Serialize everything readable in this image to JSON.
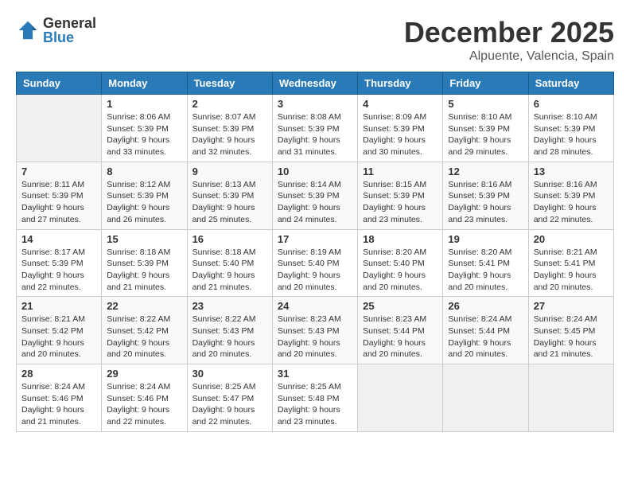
{
  "header": {
    "logo_general": "General",
    "logo_blue": "Blue",
    "month": "December 2025",
    "location": "Alpuente, Valencia, Spain"
  },
  "days_of_week": [
    "Sunday",
    "Monday",
    "Tuesday",
    "Wednesday",
    "Thursday",
    "Friday",
    "Saturday"
  ],
  "weeks": [
    [
      {
        "day": "",
        "info": ""
      },
      {
        "day": "1",
        "info": "Sunrise: 8:06 AM\nSunset: 5:39 PM\nDaylight: 9 hours\nand 33 minutes."
      },
      {
        "day": "2",
        "info": "Sunrise: 8:07 AM\nSunset: 5:39 PM\nDaylight: 9 hours\nand 32 minutes."
      },
      {
        "day": "3",
        "info": "Sunrise: 8:08 AM\nSunset: 5:39 PM\nDaylight: 9 hours\nand 31 minutes."
      },
      {
        "day": "4",
        "info": "Sunrise: 8:09 AM\nSunset: 5:39 PM\nDaylight: 9 hours\nand 30 minutes."
      },
      {
        "day": "5",
        "info": "Sunrise: 8:10 AM\nSunset: 5:39 PM\nDaylight: 9 hours\nand 29 minutes."
      },
      {
        "day": "6",
        "info": "Sunrise: 8:10 AM\nSunset: 5:39 PM\nDaylight: 9 hours\nand 28 minutes."
      }
    ],
    [
      {
        "day": "7",
        "info": "Sunrise: 8:11 AM\nSunset: 5:39 PM\nDaylight: 9 hours\nand 27 minutes."
      },
      {
        "day": "8",
        "info": "Sunrise: 8:12 AM\nSunset: 5:39 PM\nDaylight: 9 hours\nand 26 minutes."
      },
      {
        "day": "9",
        "info": "Sunrise: 8:13 AM\nSunset: 5:39 PM\nDaylight: 9 hours\nand 25 minutes."
      },
      {
        "day": "10",
        "info": "Sunrise: 8:14 AM\nSunset: 5:39 PM\nDaylight: 9 hours\nand 24 minutes."
      },
      {
        "day": "11",
        "info": "Sunrise: 8:15 AM\nSunset: 5:39 PM\nDaylight: 9 hours\nand 23 minutes."
      },
      {
        "day": "12",
        "info": "Sunrise: 8:16 AM\nSunset: 5:39 PM\nDaylight: 9 hours\nand 23 minutes."
      },
      {
        "day": "13",
        "info": "Sunrise: 8:16 AM\nSunset: 5:39 PM\nDaylight: 9 hours\nand 22 minutes."
      }
    ],
    [
      {
        "day": "14",
        "info": "Sunrise: 8:17 AM\nSunset: 5:39 PM\nDaylight: 9 hours\nand 22 minutes."
      },
      {
        "day": "15",
        "info": "Sunrise: 8:18 AM\nSunset: 5:39 PM\nDaylight: 9 hours\nand 21 minutes."
      },
      {
        "day": "16",
        "info": "Sunrise: 8:18 AM\nSunset: 5:40 PM\nDaylight: 9 hours\nand 21 minutes."
      },
      {
        "day": "17",
        "info": "Sunrise: 8:19 AM\nSunset: 5:40 PM\nDaylight: 9 hours\nand 20 minutes."
      },
      {
        "day": "18",
        "info": "Sunrise: 8:20 AM\nSunset: 5:40 PM\nDaylight: 9 hours\nand 20 minutes."
      },
      {
        "day": "19",
        "info": "Sunrise: 8:20 AM\nSunset: 5:41 PM\nDaylight: 9 hours\nand 20 minutes."
      },
      {
        "day": "20",
        "info": "Sunrise: 8:21 AM\nSunset: 5:41 PM\nDaylight: 9 hours\nand 20 minutes."
      }
    ],
    [
      {
        "day": "21",
        "info": "Sunrise: 8:21 AM\nSunset: 5:42 PM\nDaylight: 9 hours\nand 20 minutes."
      },
      {
        "day": "22",
        "info": "Sunrise: 8:22 AM\nSunset: 5:42 PM\nDaylight: 9 hours\nand 20 minutes."
      },
      {
        "day": "23",
        "info": "Sunrise: 8:22 AM\nSunset: 5:43 PM\nDaylight: 9 hours\nand 20 minutes."
      },
      {
        "day": "24",
        "info": "Sunrise: 8:23 AM\nSunset: 5:43 PM\nDaylight: 9 hours\nand 20 minutes."
      },
      {
        "day": "25",
        "info": "Sunrise: 8:23 AM\nSunset: 5:44 PM\nDaylight: 9 hours\nand 20 minutes."
      },
      {
        "day": "26",
        "info": "Sunrise: 8:24 AM\nSunset: 5:44 PM\nDaylight: 9 hours\nand 20 minutes."
      },
      {
        "day": "27",
        "info": "Sunrise: 8:24 AM\nSunset: 5:45 PM\nDaylight: 9 hours\nand 21 minutes."
      }
    ],
    [
      {
        "day": "28",
        "info": "Sunrise: 8:24 AM\nSunset: 5:46 PM\nDaylight: 9 hours\nand 21 minutes."
      },
      {
        "day": "29",
        "info": "Sunrise: 8:24 AM\nSunset: 5:46 PM\nDaylight: 9 hours\nand 22 minutes."
      },
      {
        "day": "30",
        "info": "Sunrise: 8:25 AM\nSunset: 5:47 PM\nDaylight: 9 hours\nand 22 minutes."
      },
      {
        "day": "31",
        "info": "Sunrise: 8:25 AM\nSunset: 5:48 PM\nDaylight: 9 hours\nand 23 minutes."
      },
      {
        "day": "",
        "info": ""
      },
      {
        "day": "",
        "info": ""
      },
      {
        "day": "",
        "info": ""
      }
    ]
  ]
}
